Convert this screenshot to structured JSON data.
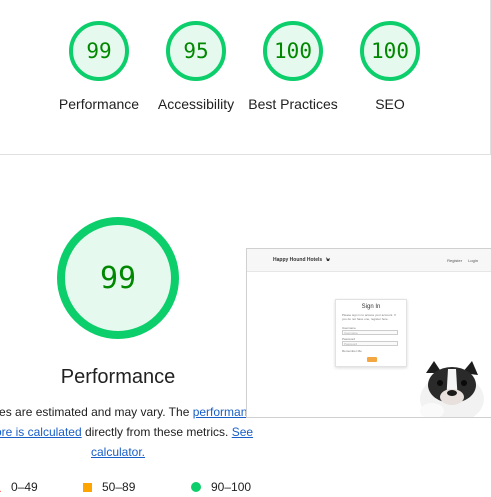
{
  "summary_scores": [
    {
      "value": "99",
      "label": "Performance"
    },
    {
      "value": "95",
      "label": "Accessibility"
    },
    {
      "value": "100",
      "label": "Best Practices"
    },
    {
      "value": "100",
      "label": "SEO"
    }
  ],
  "main_gauge": {
    "value": "99",
    "score_fraction": 0.99,
    "title": "Performance"
  },
  "description": {
    "text_before": "Values are estimated and may vary. The ",
    "link1": "performance score is calculated",
    "text_middle": " directly from these metrics. ",
    "link2": "See calculator."
  },
  "legend": [
    {
      "range": "0–49",
      "shape": "triangle",
      "color": "#ff4e42"
    },
    {
      "range": "50–89",
      "shape": "square",
      "color": "#ffa400"
    },
    {
      "range": "90–100",
      "shape": "circle",
      "color": "#0cce6b"
    }
  ],
  "screenshot": {
    "brand": "Happy Hound Hotels",
    "nav_links": [
      "Register",
      "Login"
    ],
    "card_title": "Sign In",
    "card_text": "Please sign in to access your account. If you do not have one, register here.",
    "username_label": "Username",
    "username_placeholder": "Username",
    "password_label": "Password",
    "password_placeholder": "Password",
    "remember_label": "Remember Me"
  },
  "colors": {
    "pass_green": "#0cce6b",
    "pass_text": "#008800",
    "pass_bg": "#e6f9ee",
    "average": "#ffa400",
    "fail": "#ff4e42",
    "link": "#1a5fc7"
  }
}
